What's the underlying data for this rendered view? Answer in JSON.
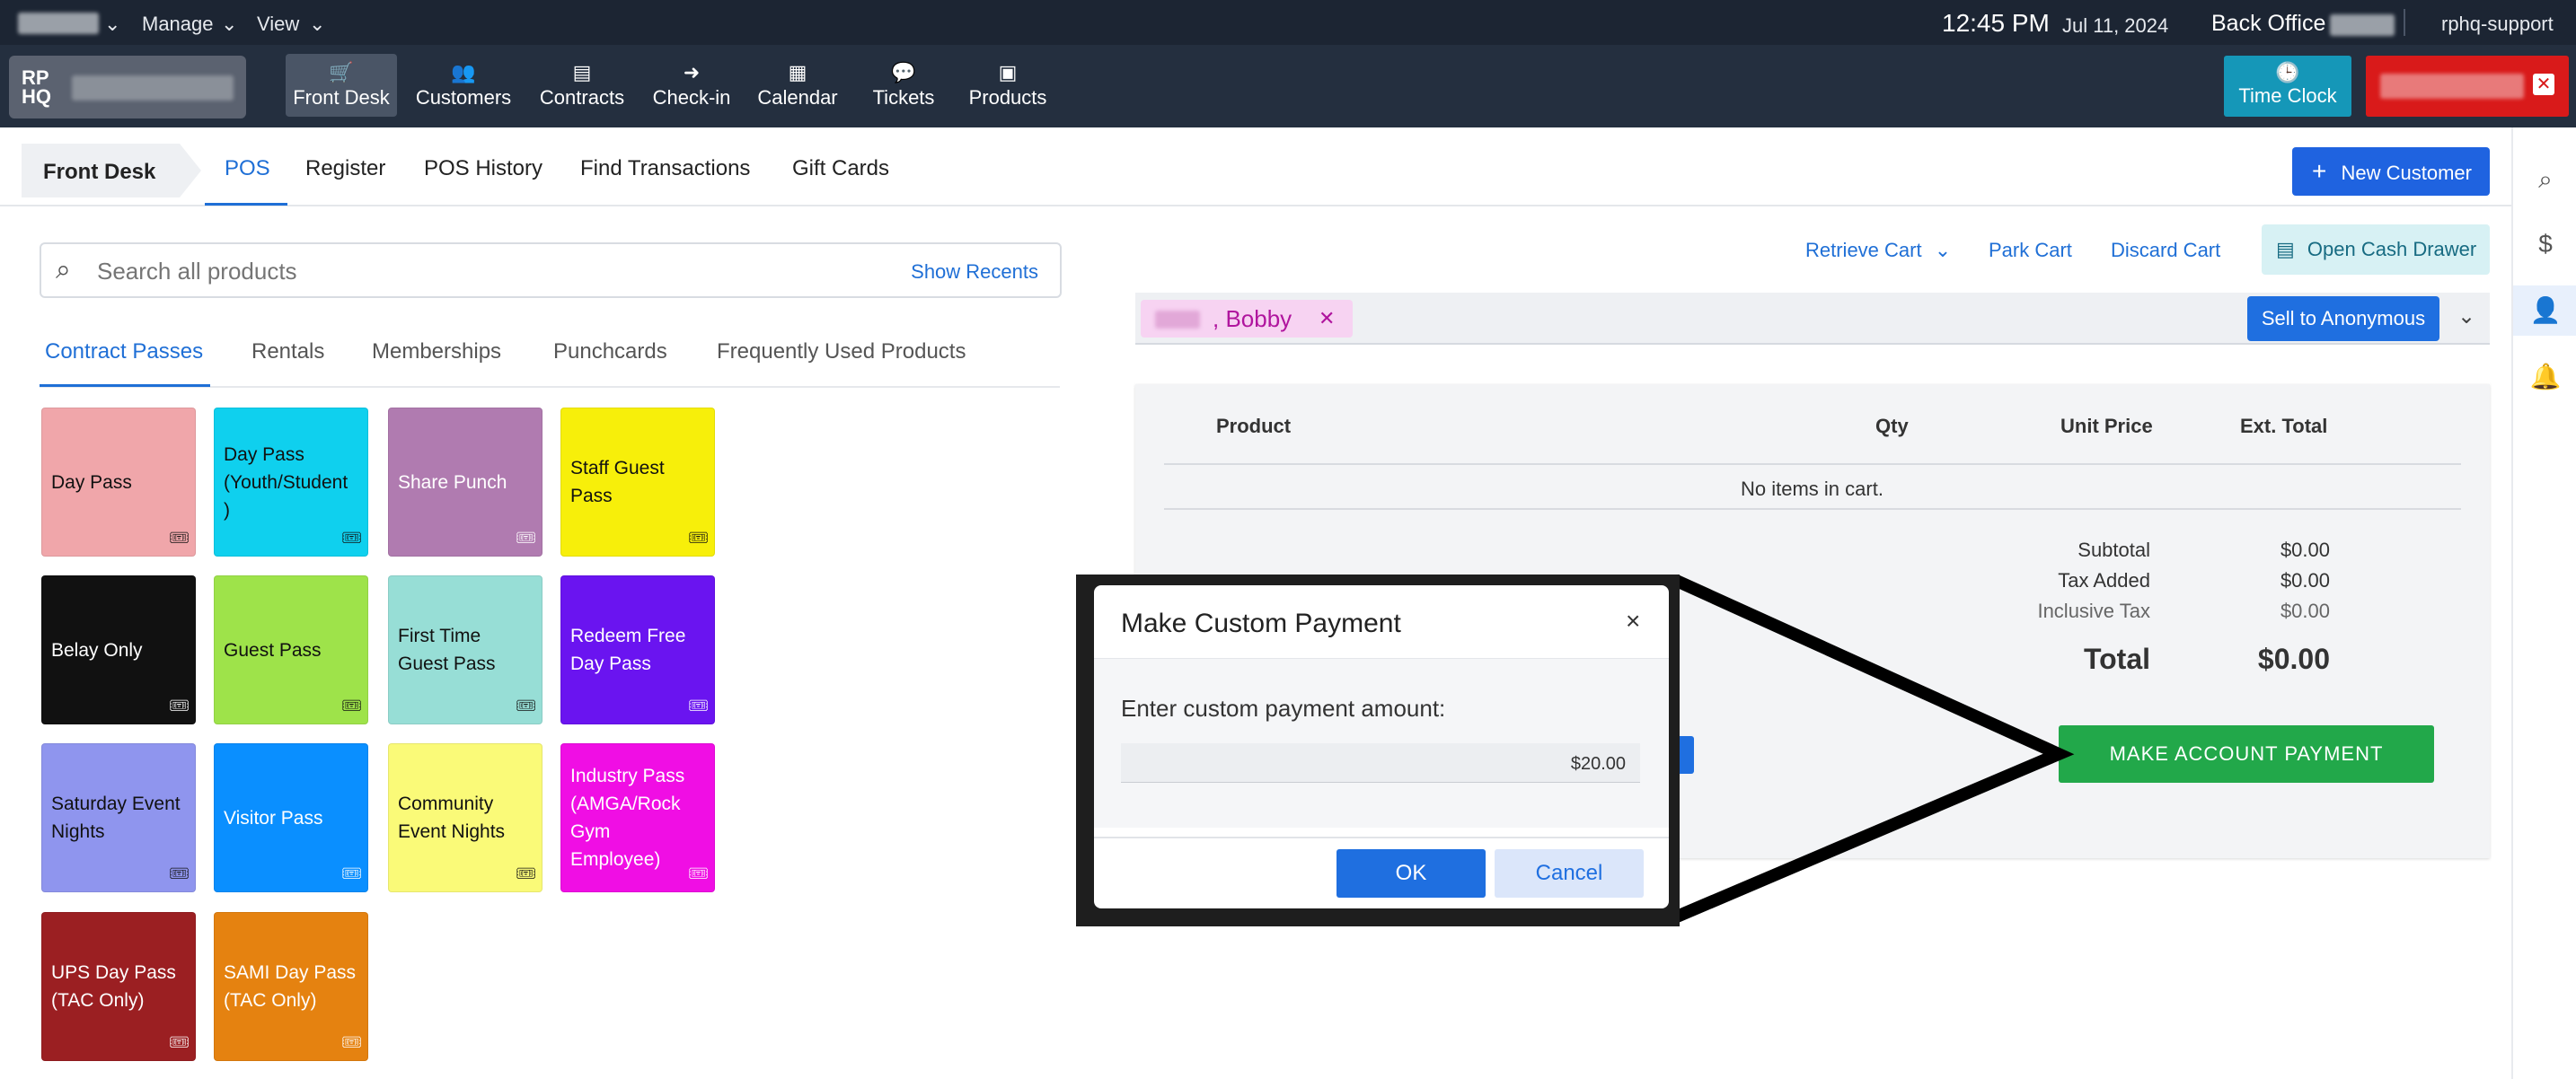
{
  "menubar": {
    "manage": "Manage",
    "view": "View",
    "time": "12:45 PM",
    "date": "Jul 11, 2024",
    "location": "Back Office",
    "user": "rphq-support"
  },
  "logo": {
    "line1": "RP",
    "line2": "HQ"
  },
  "nav": [
    {
      "label": "Front Desk",
      "icon": "cart-icon"
    },
    {
      "label": "Customers",
      "icon": "users-icon"
    },
    {
      "label": "Contracts",
      "icon": "contracts-icon"
    },
    {
      "label": "Check-in",
      "icon": "checkin-icon"
    },
    {
      "label": "Calendar",
      "icon": "calendar-icon"
    },
    {
      "label": "Tickets",
      "icon": "tickets-icon"
    },
    {
      "label": "Products",
      "icon": "products-icon"
    }
  ],
  "time_clock": "Time Clock",
  "subnav": {
    "section": "Front Desk",
    "tabs": [
      "POS",
      "Register",
      "POS History",
      "Find Transactions",
      "Gift Cards"
    ],
    "new_customer": "New Customer"
  },
  "search": {
    "placeholder": "Search all products",
    "show_recents": "Show Recents"
  },
  "category_tabs": [
    "Contract Passes",
    "Rentals",
    "Memberships",
    "Punchcards",
    "Frequently Used Products"
  ],
  "products": [
    {
      "name": "Day Pass",
      "color": "#f0a6aa"
    },
    {
      "name": "Day Pass (Youth/Student )",
      "color": "#0fd0ee"
    },
    {
      "name": "Share Punch",
      "color": "#b07bb0"
    },
    {
      "name": "Staff Guest Pass",
      "color": "#f7ef0a"
    },
    {
      "name": "Belay Only",
      "color": "#111111"
    },
    {
      "name": "Guest Pass",
      "color": "#9ee34a"
    },
    {
      "name": "First Time Guest Pass",
      "color": "#97ded6"
    },
    {
      "name": "Redeem Free Day Pass",
      "color": "#6a14f0"
    },
    {
      "name": "Saturday Event Nights",
      "color": "#8f95ee"
    },
    {
      "name": "Visitor Pass",
      "color": "#0a8fff"
    },
    {
      "name": "Community Event Nights",
      "color": "#fafa78"
    },
    {
      "name": "Industry Pass (AMGA/Rock Gym Employee)",
      "color": "#f00ee4"
    },
    {
      "name": "UPS Day Pass (TAC Only)",
      "color": "#9b1f22"
    },
    {
      "name": "SAMI Day Pass (TAC Only)",
      "color": "#e58210"
    }
  ],
  "cart_actions": {
    "retrieve": "Retrieve Cart",
    "park": "Park Cart",
    "discard": "Discard Cart",
    "open_drawer": "Open Cash Drawer"
  },
  "customer_chip": ", Bobby",
  "sell_anonymous": "Sell to Anonymous",
  "cart": {
    "headers": [
      "Product",
      "Qty",
      "Unit Price",
      "Ext. Total"
    ],
    "empty": "No items in cart.",
    "subtotal_label": "Subtotal",
    "subtotal": "$0.00",
    "tax_label": "Tax Added",
    "tax": "$0.00",
    "incl_label": "Inclusive Tax",
    "incl": "$0.00",
    "total_label": "Total",
    "total": "$0.00",
    "make_payment": "MAKE ACCOUNT PAYMENT"
  },
  "modal": {
    "title": "Make Custom Payment",
    "prompt": "Enter custom payment amount:",
    "amount": "$20.00",
    "ok": "OK",
    "cancel": "Cancel"
  },
  "colors": {
    "accent": "#1f6fd6",
    "nav_bg": "#242f3f",
    "time_clock_bg": "#1597b8",
    "make_payment_bg": "#22a84a",
    "ok_bg": "#1f6fe0"
  }
}
